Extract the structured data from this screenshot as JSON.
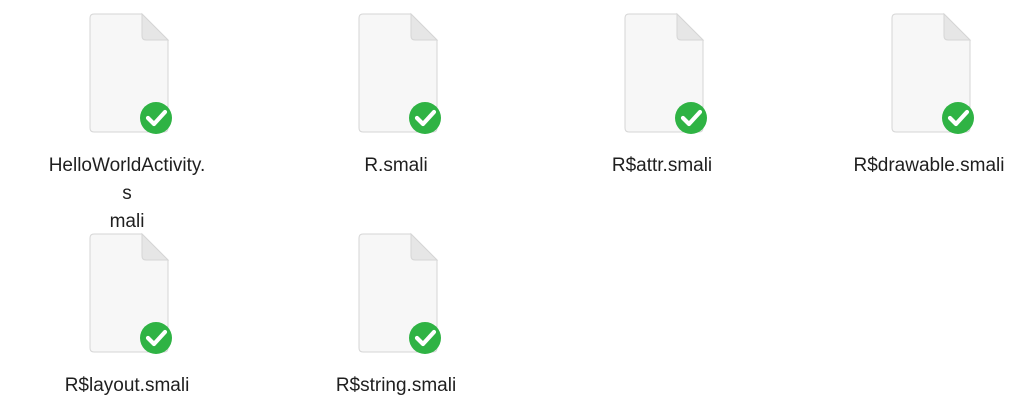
{
  "window": {
    "view": "icon-view"
  },
  "files": [
    {
      "name": "HelloWorldActivity.s mali",
      "icon": "document-icon",
      "badge": "checkmark-icon",
      "badge_color": "#2fb344"
    },
    {
      "name": "R.smali",
      "icon": "document-icon",
      "badge": "checkmark-icon",
      "badge_color": "#2fb344"
    },
    {
      "name": "R$attr.smali",
      "icon": "document-icon",
      "badge": "checkmark-icon",
      "badge_color": "#2fb344"
    },
    {
      "name": "R$drawable.smali",
      "icon": "document-icon",
      "badge": "checkmark-icon",
      "badge_color": "#2fb344"
    },
    {
      "name": "R$layout.smali",
      "icon": "document-icon",
      "badge": "checkmark-icon",
      "badge_color": "#2fb344"
    },
    {
      "name": "R$string.smali",
      "icon": "document-icon",
      "badge": "checkmark-icon",
      "badge_color": "#2fb344"
    }
  ]
}
